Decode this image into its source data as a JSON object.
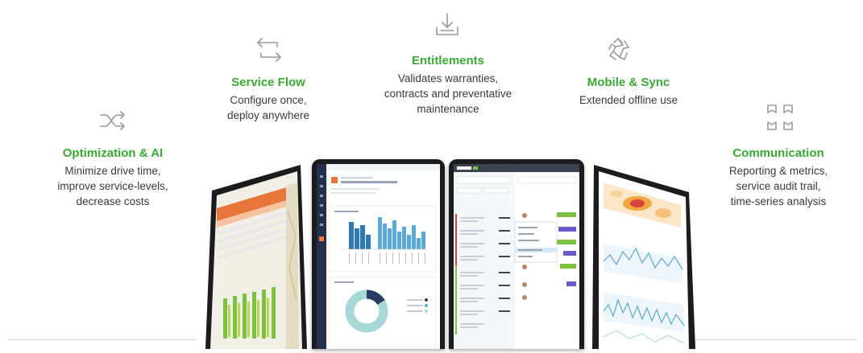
{
  "colors": {
    "accent": "#3aa935",
    "text": "#3a3a3a",
    "icon": "#9a9a9a",
    "device_frame": "#1c1c1e",
    "chart_blue": "#5aa9d6",
    "chart_navy": "#2a3c64",
    "chart_teal": "#a6d8d8",
    "heatmap_red": "#d94040",
    "heatmap_orange": "#f2a640",
    "scheduler_orange": "#e8763a",
    "scheduler_green": "#7bc142"
  },
  "features": [
    {
      "id": "optimization",
      "icon": "shuffle-icon",
      "title": "Optimization & AI",
      "lines": [
        "Minimize drive time,",
        "improve service-levels,",
        "decrease costs"
      ]
    },
    {
      "id": "service_flow",
      "icon": "arrows-exchange-icon",
      "title": "Service Flow",
      "lines": [
        "Configure once,",
        "deploy anywhere"
      ]
    },
    {
      "id": "entitlements",
      "icon": "download-tray-icon",
      "title": "Entitlements",
      "lines": [
        "Validates warranties,",
        "contracts and preventative",
        "maintenance"
      ]
    },
    {
      "id": "mobile_sync",
      "icon": "recycle-icon",
      "title": "Mobile & Sync",
      "lines": [
        "Extended offline use"
      ]
    },
    {
      "id": "communication",
      "icon": "grid-squares-icon",
      "title": "Communication",
      "lines": [
        "Reporting & metrics,",
        "service audit trail,",
        "time-series analysis"
      ]
    }
  ],
  "devices": [
    {
      "id": "tablet-1",
      "content": "scheduler-map-screen"
    },
    {
      "id": "tablet-2",
      "content": "performance-metrics-screen"
    },
    {
      "id": "tablet-3",
      "content": "dispatch-board-screen"
    },
    {
      "id": "tablet-4",
      "content": "analytics-heatmap-screen"
    }
  ]
}
